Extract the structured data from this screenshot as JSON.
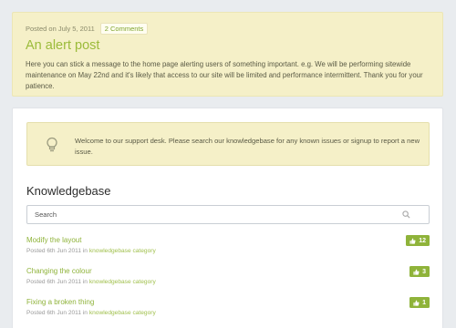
{
  "alert": {
    "date": "Posted on July 5, 2011",
    "comments": "2 Comments",
    "title": "An alert post",
    "body": "Here you can stick a message to the home page alerting users of something important. e.g. We will be performing sitewide maintenance on May 22nd and it's likely that access to our site will be limited and performance intermittent. Thank you for your patience."
  },
  "welcome": {
    "icon": "lightbulb-icon",
    "text": "Welcome to our support desk. Please search our knowledgebase for any known issues or signup to report a new issue."
  },
  "knowledgebase": {
    "title": "Knowledgebase",
    "search_placeholder": "Search",
    "items": [
      {
        "title": "Modify the layout",
        "meta_prefix": "Posted 6th Jun 2011 in",
        "category": "knowledgebase category",
        "votes": "12"
      },
      {
        "title": "Changing the colour",
        "meta_prefix": "Posted 6th Jun 2011 in",
        "category": "knowledgebase category",
        "votes": "3"
      },
      {
        "title": "Fixing a broken thing",
        "meta_prefix": "Posted 6th Jun 2011 in",
        "category": "knowledgebase category",
        "votes": "1"
      }
    ]
  },
  "colors": {
    "accent": "#8fb33a",
    "alert_bg": "#f5f0c8",
    "page_bg": "#e9ecef"
  }
}
